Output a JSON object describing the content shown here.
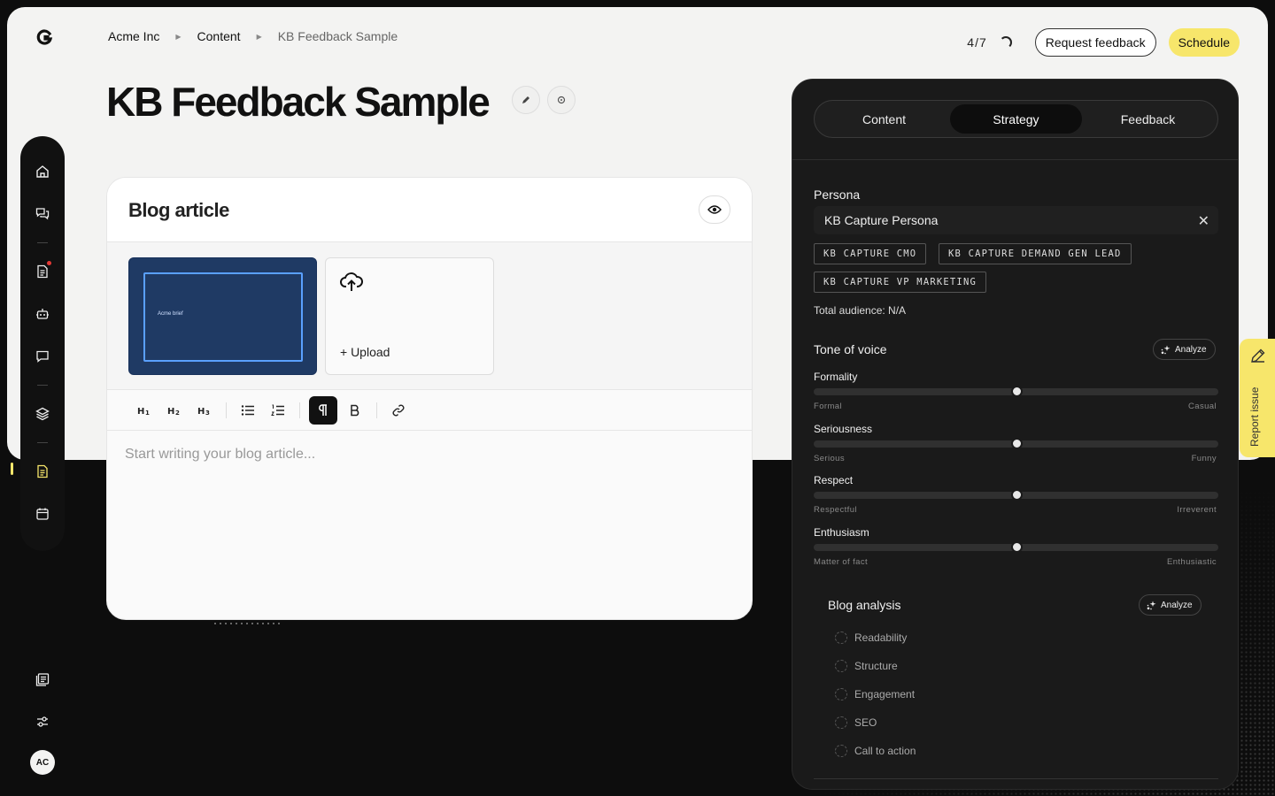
{
  "breadcrumb": {
    "items": [
      "Acme Inc",
      "Content",
      "KB Feedback Sample"
    ]
  },
  "header": {
    "progress": "4/7",
    "request_feedback_label": "Request feedback",
    "schedule_label": "Schedule"
  },
  "page": {
    "title": "KB Feedback Sample"
  },
  "editor": {
    "title": "Blog article",
    "thumbnail_caption": "Acme brief",
    "upload_label": "+ Upload",
    "toolbar": [
      "H1",
      "H2",
      "H3",
      "bulleted-list",
      "numbered-list",
      "paragraph",
      "bold",
      "link"
    ],
    "placeholder": "Start writing your blog article..."
  },
  "sidebar": {
    "items": [
      "home",
      "conversations",
      "documents",
      "bot",
      "messages",
      "layers",
      "content",
      "calendar"
    ],
    "bottom_items": [
      "library",
      "settings"
    ],
    "avatar_initials": "AC"
  },
  "panel": {
    "tabs": [
      {
        "label": "Content",
        "active": false
      },
      {
        "label": "Strategy",
        "active": true
      },
      {
        "label": "Feedback",
        "active": false
      }
    ],
    "persona": {
      "label": "Persona",
      "value": "KB Capture Persona",
      "chips": [
        "KB CAPTURE CMO",
        "KB CAPTURE DEMAND GEN LEAD",
        "KB CAPTURE VP MARKETING"
      ],
      "audience": "Total audience: N/A"
    },
    "tone": {
      "label": "Tone of voice",
      "analyze_label": "Analyze",
      "sliders": [
        {
          "label": "Formality",
          "min": "Formal",
          "max": "Casual",
          "value": 0.5
        },
        {
          "label": "Seriousness",
          "min": "Serious",
          "max": "Funny",
          "value": 0.5
        },
        {
          "label": "Respect",
          "min": "Respectful",
          "max": "Irreverent",
          "value": 0.5
        },
        {
          "label": "Enthusiasm",
          "min": "Matter of fact",
          "max": "Enthusiastic",
          "value": 0.5
        }
      ]
    },
    "analysis": {
      "label": "Blog analysis",
      "analyze_label": "Analyze",
      "items": [
        "Readability",
        "Structure",
        "Engagement",
        "SEO",
        "Call to action"
      ]
    }
  },
  "report_issue_label": "Report issue",
  "colors": {
    "accent_yellow": "#f7e66b",
    "panel_dark": "#1a1a1a",
    "thumbnail_blue": "#1f3a64"
  }
}
